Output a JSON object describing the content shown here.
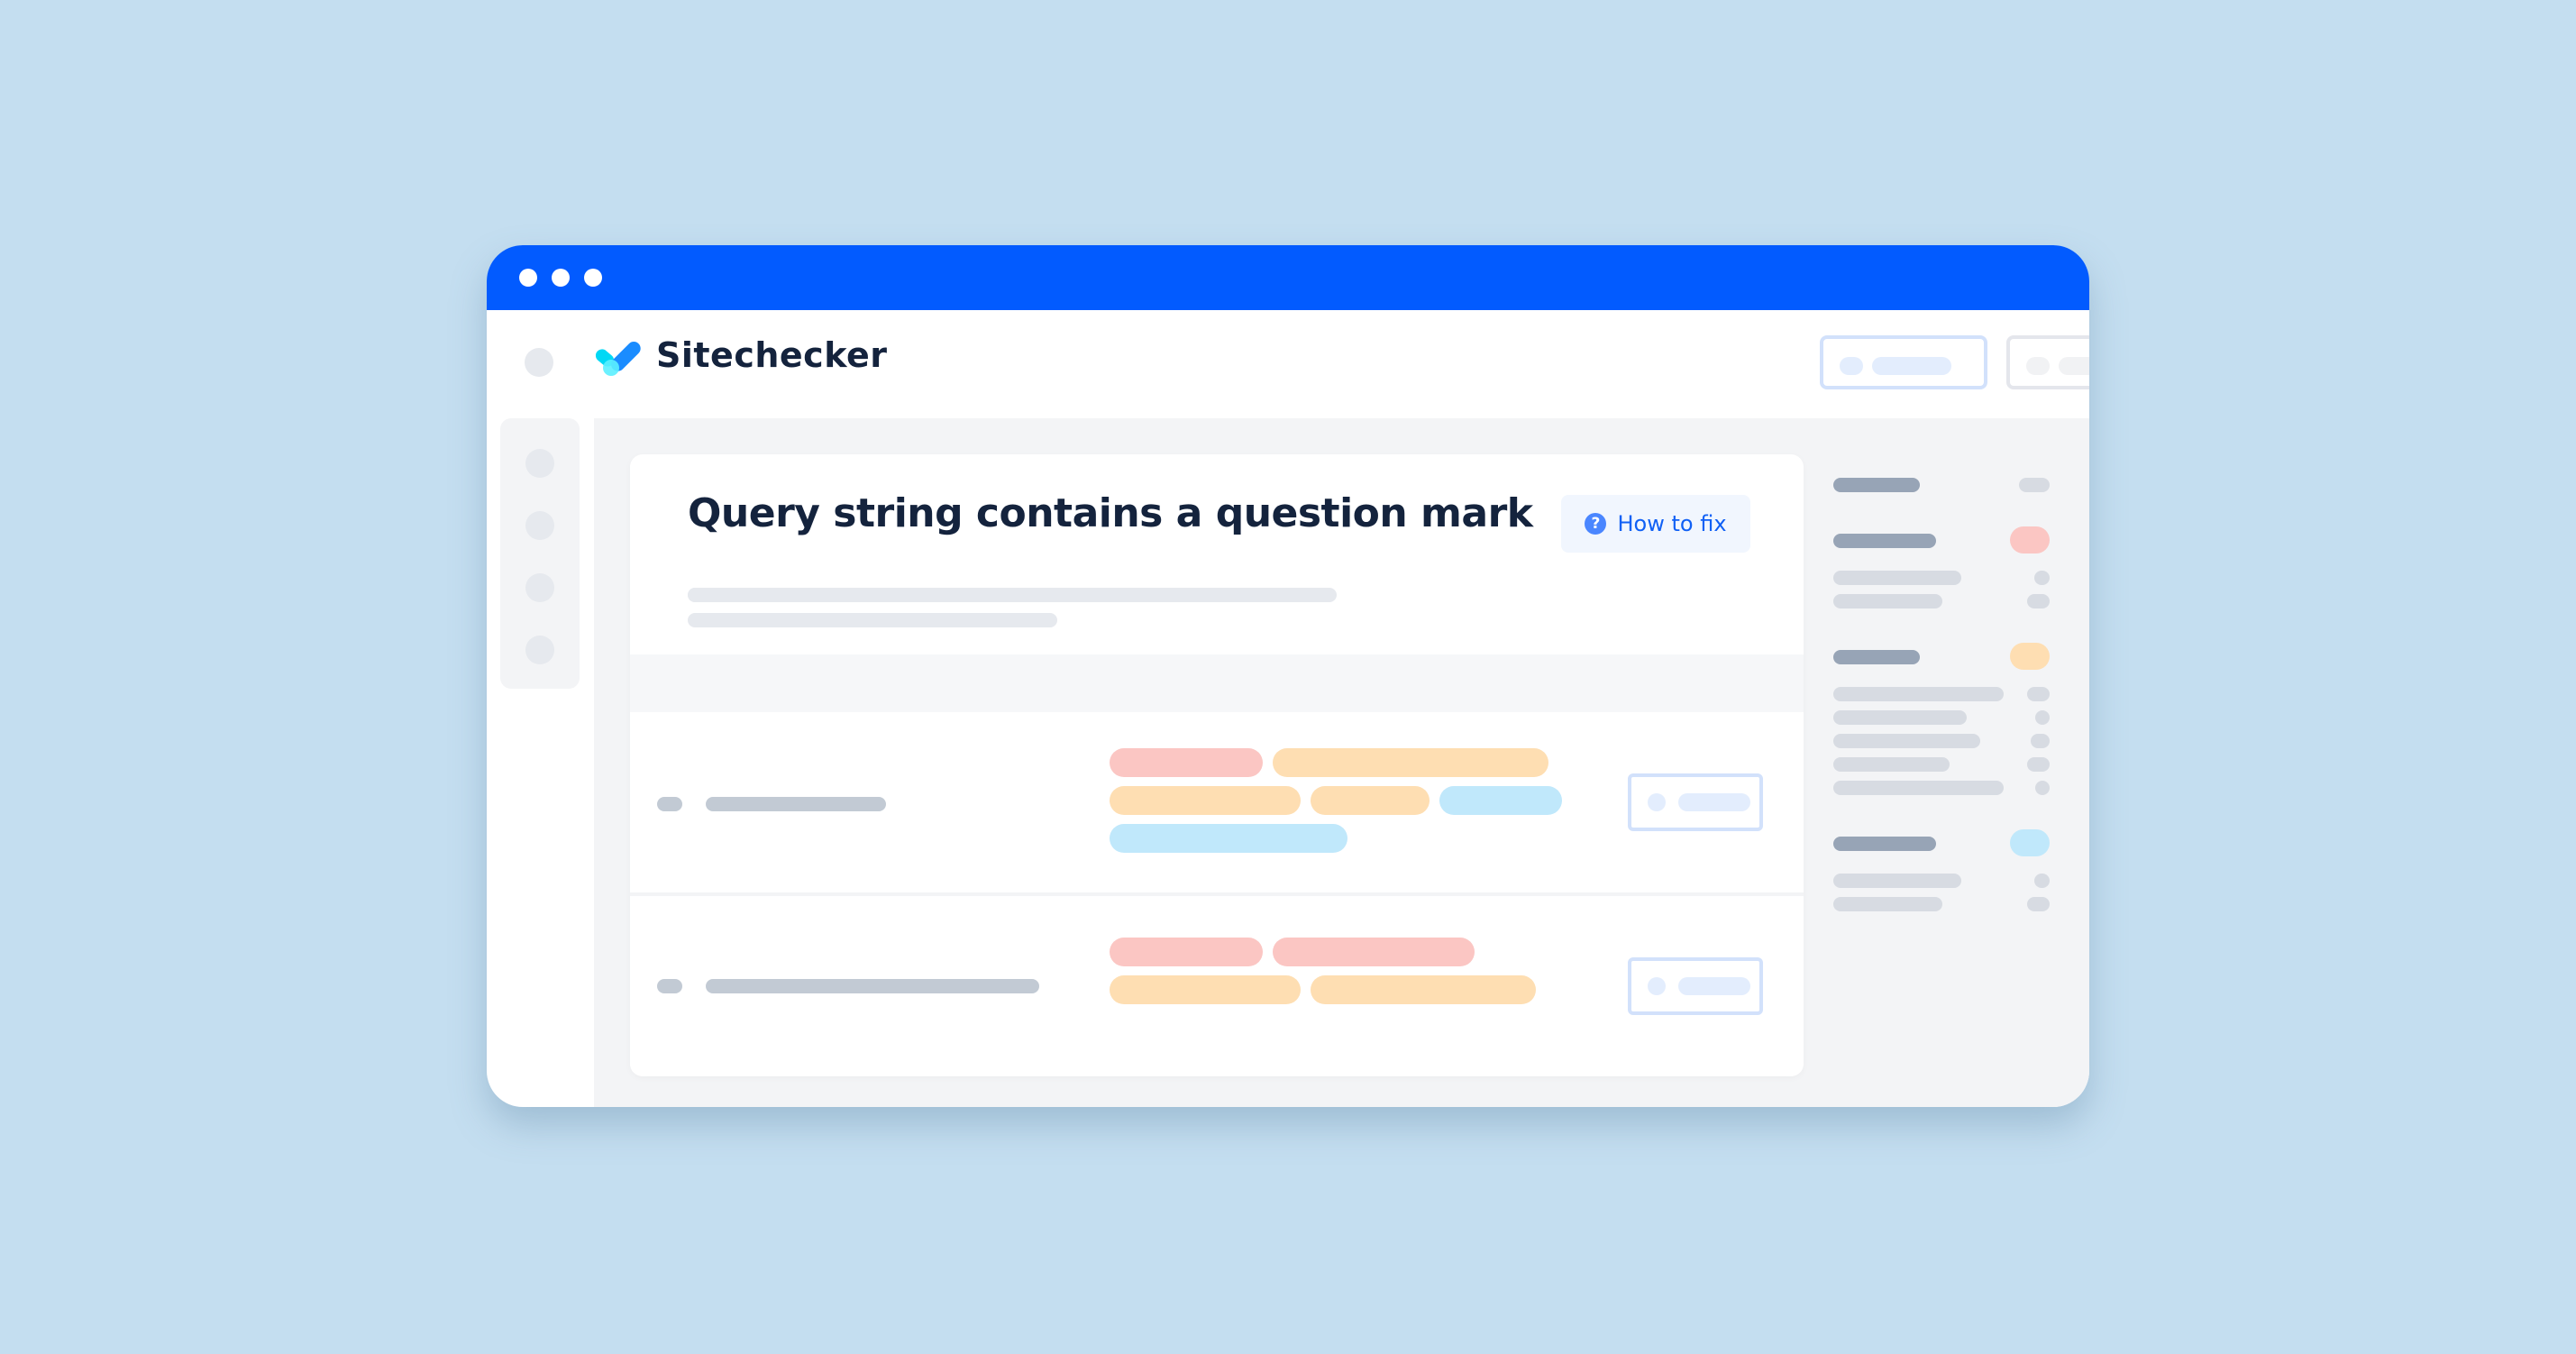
{
  "window": {
    "titlebar_color": "#025bff",
    "controls": [
      "dot",
      "dot",
      "dot"
    ]
  },
  "header": {
    "brand_name": "Sitechecker",
    "logo_icon": "checkmark-logo-icon",
    "buttons": [
      {
        "name": "primary-header-button",
        "style": "blue-outline",
        "label": ""
      },
      {
        "name": "secondary-header-button",
        "style": "gray-outline",
        "label": ""
      }
    ]
  },
  "left_sidebar": {
    "items": [
      "nav-item-1",
      "nav-item-2",
      "nav-item-3",
      "nav-item-4"
    ]
  },
  "main": {
    "issue_title": "Query string contains a question mark",
    "how_to_fix": {
      "label": "How to fix",
      "icon": "question-icon",
      "icon_glyph": "?"
    },
    "rows": [
      {
        "tags": [
          [
            "red",
            "orange"
          ],
          [
            "orange",
            "orange",
            "blue"
          ],
          [
            "blue"
          ]
        ]
      },
      {
        "tags": [
          [
            "red",
            "red"
          ],
          [
            "orange",
            "orange"
          ]
        ]
      }
    ]
  },
  "right_sidebar": {
    "groups": [
      {
        "badge": "gray",
        "items": 0
      },
      {
        "badge": "red",
        "items": 2
      },
      {
        "badge": "orange",
        "items": 5
      },
      {
        "badge": "blue",
        "items": 2
      }
    ]
  },
  "colors": {
    "accent": "#025bff",
    "link": "#1060f5",
    "title": "#14233d",
    "tag_red": "#fbc6c3",
    "tag_orange": "#fedeb2",
    "tag_blue": "#c0e8fb",
    "background": "#c4def0"
  }
}
